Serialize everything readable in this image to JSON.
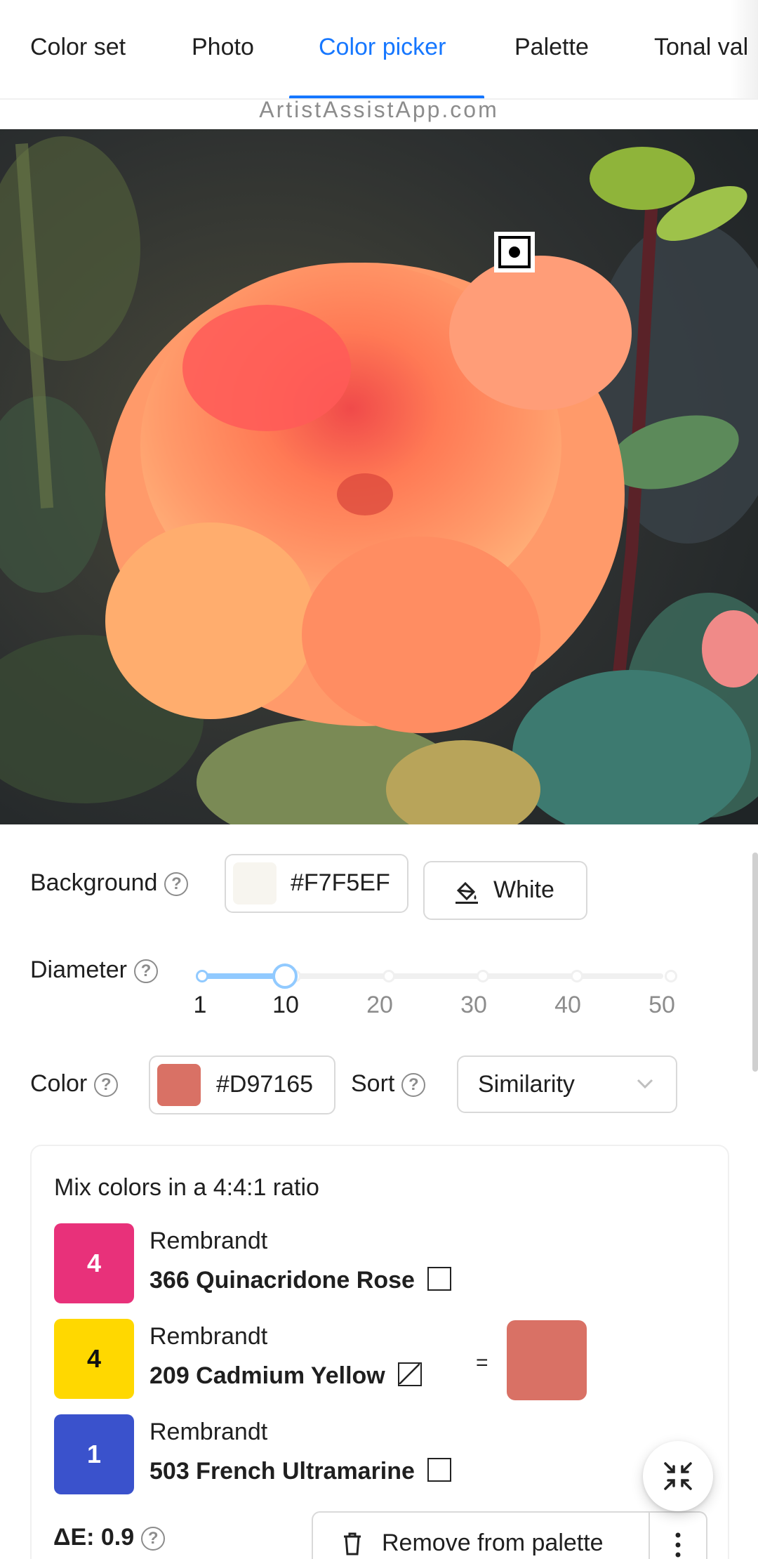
{
  "tabs": [
    {
      "label": "Color set"
    },
    {
      "label": "Photo"
    },
    {
      "label": "Color picker",
      "active": true
    },
    {
      "label": "Palette"
    },
    {
      "label": "Tonal val"
    }
  ],
  "site": "ArtistAssistApp.com",
  "photo": {
    "alt": "orange dahlia photo",
    "sampler_icon": "target-sampler-icon"
  },
  "background": {
    "label": "Background",
    "hex": "#F7F5EF",
    "swatch_color": "#F7F5EF",
    "button_label": "White",
    "button_icon": "paint-bucket-icon"
  },
  "diameter": {
    "label": "Diameter",
    "value": 10,
    "min": 1,
    "max": 50,
    "marks": [
      "1",
      "10",
      "20",
      "30",
      "40",
      "50"
    ]
  },
  "color": {
    "label": "Color",
    "hex": "#D97165",
    "swatch_color": "#D97165"
  },
  "sort": {
    "label": "Sort",
    "value": "Similarity"
  },
  "mix": {
    "title": "Mix colors in a 4:4:1 ratio",
    "items": [
      {
        "parts": "4",
        "color": "#E8317A",
        "brand": "Rembrandt",
        "name": "366 Quinacridone Rose",
        "checkbox": "empty"
      },
      {
        "parts": "4",
        "color": "#FFD800",
        "brand": "Rembrandt",
        "name": "209 Cadmium Yellow",
        "checkbox": "diagonal"
      },
      {
        "parts": "1",
        "color": "#3A52CC",
        "brand": "Rembrandt",
        "name": "503 French Ultramarine",
        "checkbox": "empty"
      }
    ],
    "equals": "=",
    "result_color": "#D97165",
    "delta_e": "ΔE: 0.9",
    "remove_label": "Remove from palette"
  }
}
